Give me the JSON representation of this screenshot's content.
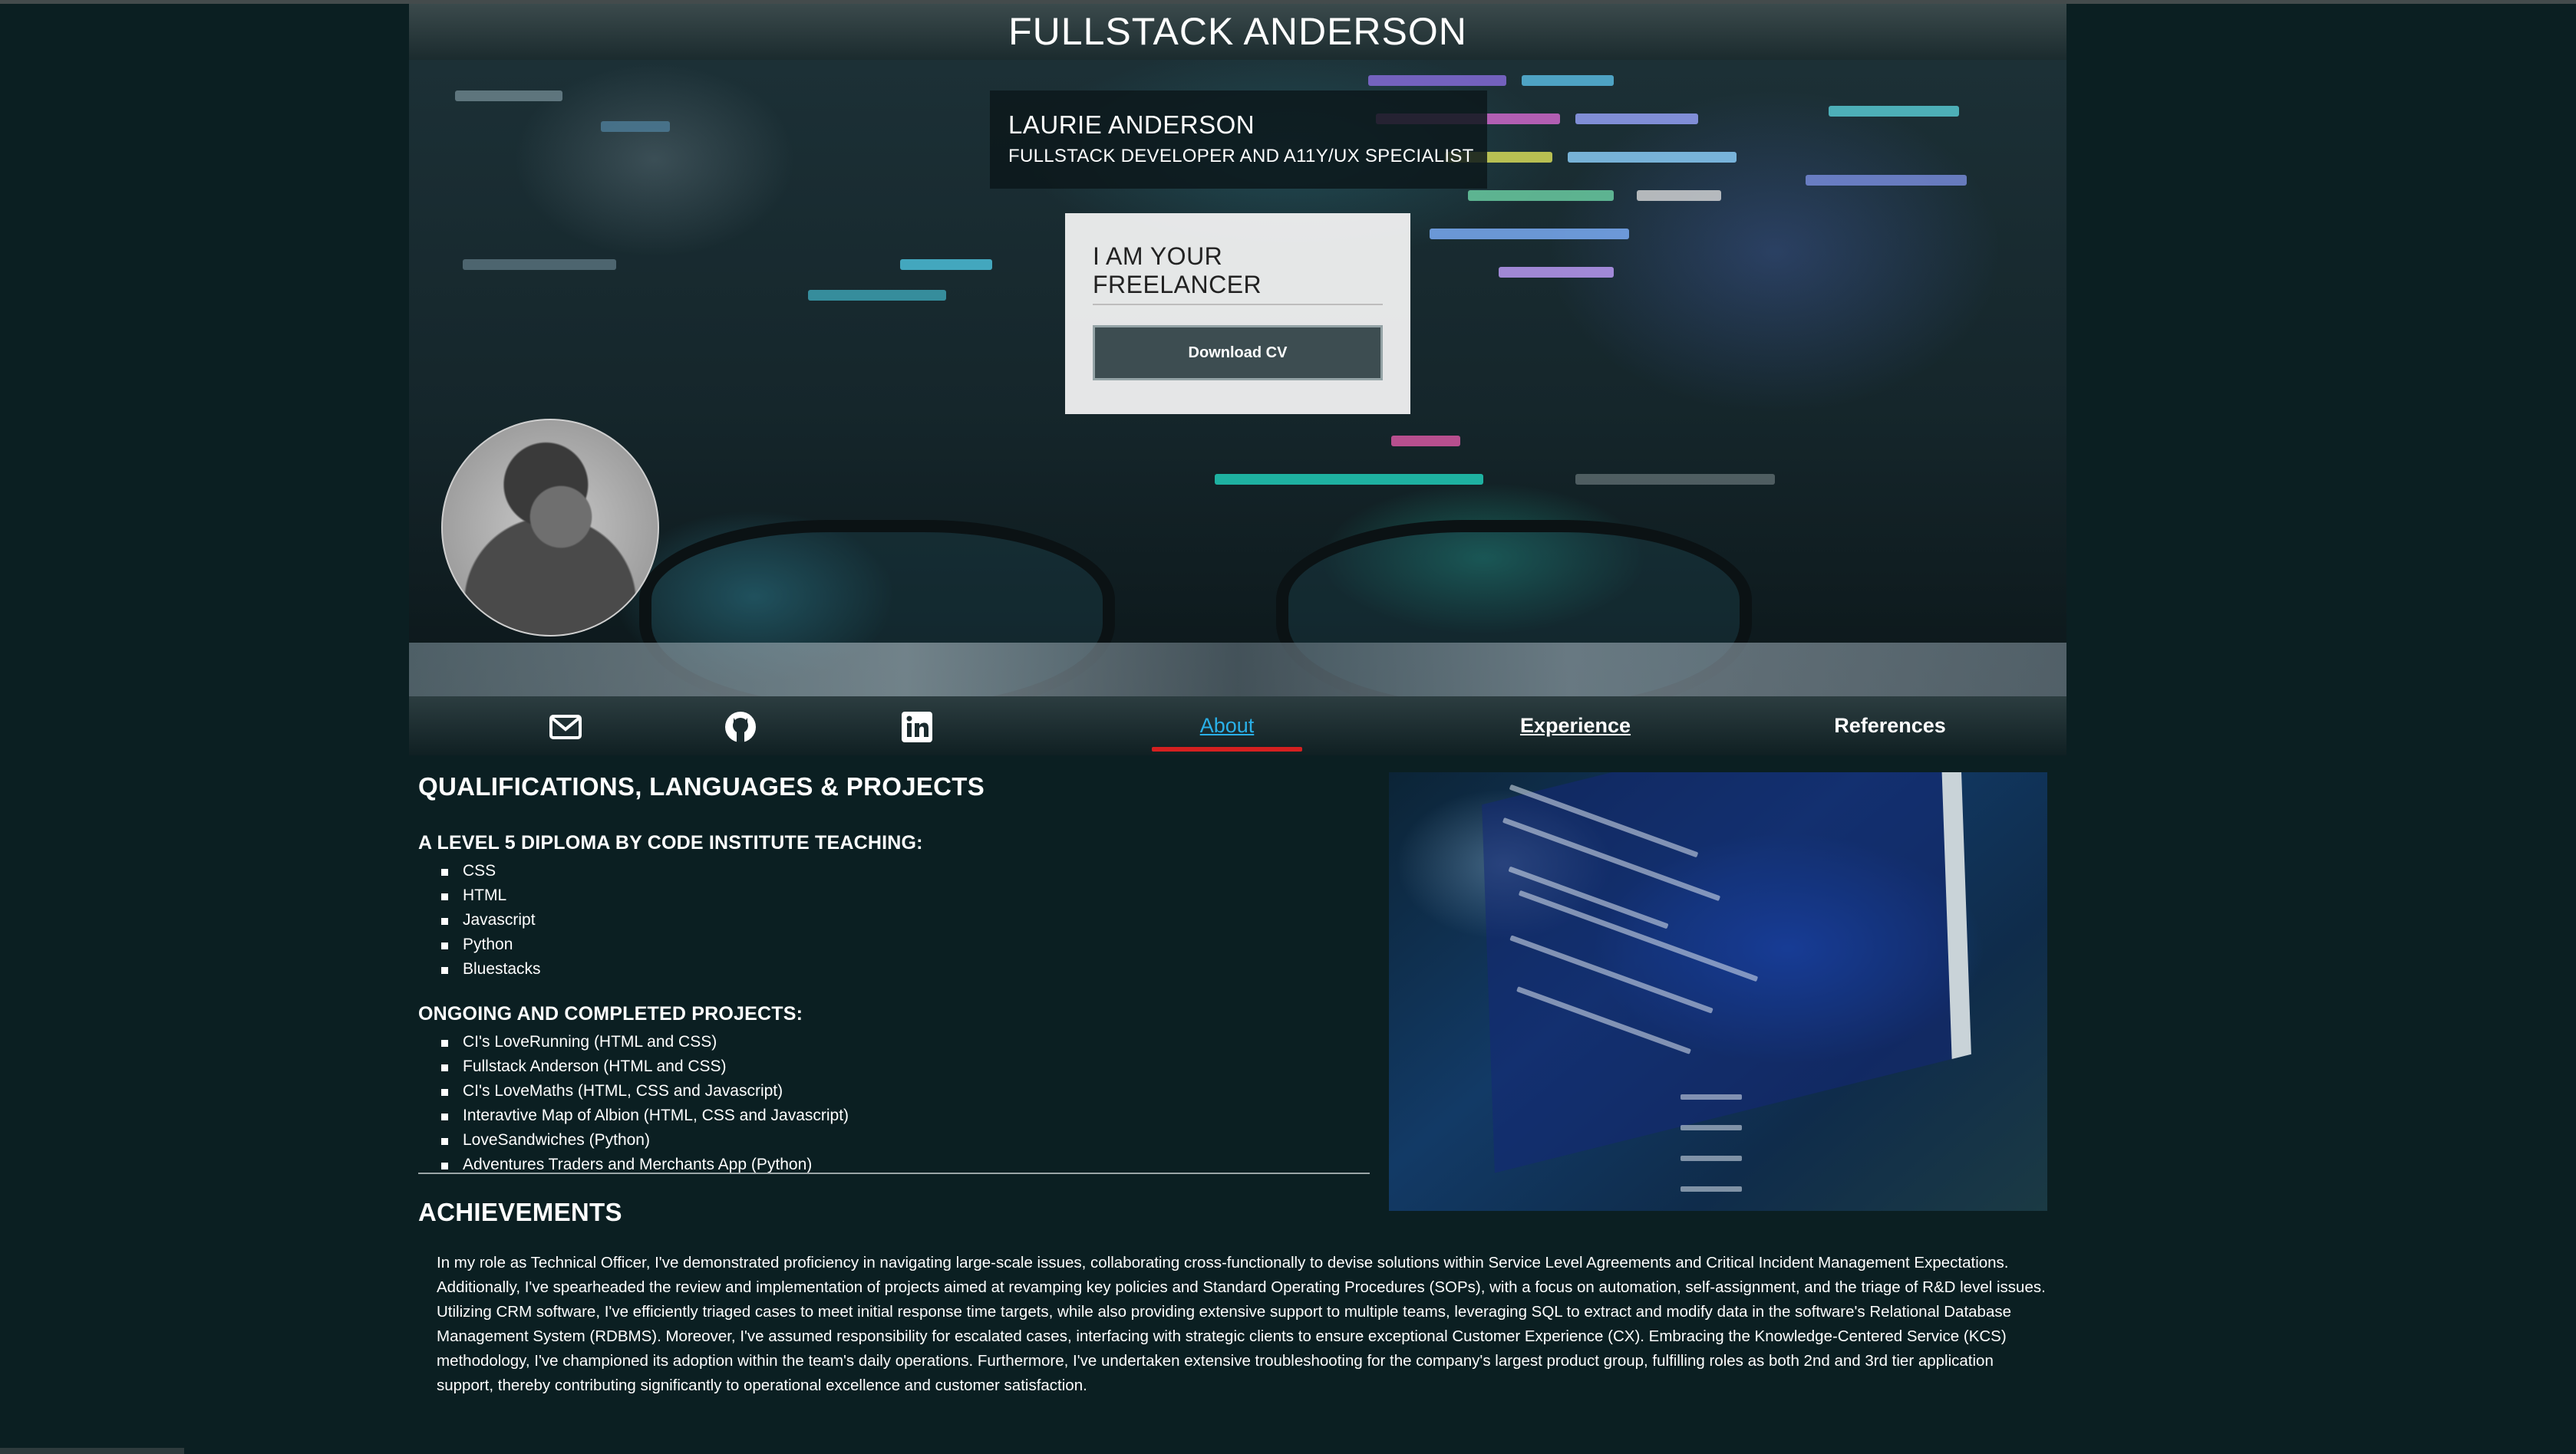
{
  "header": {
    "title": "FULLSTACK ANDERSON"
  },
  "hero": {
    "name": "LAURIE ANDERSON",
    "role": "FULLSTACK DEVELOPER AND A11Y/UX SPECIALIST",
    "freelancer_heading": "I AM YOUR FREELANCER",
    "cv_button": "Download CV"
  },
  "nav": {
    "icons": [
      "envelope-icon",
      "github-icon",
      "linkedin-icon"
    ],
    "links": {
      "about": "About",
      "experience": "Experience",
      "references": "References"
    },
    "active": "About",
    "active_color": "#2ab0e8",
    "active_underline_color": "#d42020"
  },
  "about": {
    "title": "QUALIFICATIONS, LANGUAGES & PROJECTS",
    "diploma_heading": "A LEVEL 5 DIPLOMA BY CODE INSTITUTE TEACHING:",
    "skills": [
      "CSS",
      "HTML",
      "Javascript",
      "Python",
      "Bluestacks"
    ],
    "projects_heading": "ONGOING AND COMPLETED PROJECTS:",
    "projects": [
      "CI's LoveRunning (HTML and CSS)",
      "Fullstack Anderson (HTML and CSS)",
      "CI's LoveMaths (HTML, CSS and Javascript)",
      "Interavtive Map of Albion (HTML, CSS and Javascript)",
      "LoveSandwiches (Python)",
      "Adventures Traders and Merchants App (Python)"
    ]
  },
  "achievements": {
    "title": "ACHIEVEMENTS",
    "text": "In my role as Technical Officer, I've demonstrated proficiency in navigating large-scale issues, collaborating cross-functionally to devise solutions within Service Level Agreements and Critical Incident Management Expectations. Additionally, I've spearheaded the review and implementation of projects aimed at revamping key policies and Standard Operating Procedures (SOPs), with a focus on automation, self-assignment, and the triage of R&D level issues. Utilizing CRM software, I've efficiently triaged cases to meet initial response time targets, while also providing extensive support to multiple teams, leveraging SQL to extract and modify data in the software's Relational Database Management System (RDBMS). Moreover, I've assumed responsibility for escalated cases, interfacing with strategic clients to ensure exceptional Customer Experience (CX). Embracing the Knowledge-Centered Service (KCS) methodology, I've championed its adoption within the team's daily operations. Furthermore, I've undertaken extensive troubleshooting for the company's largest product group, fulfilling roles as both 2nd and 3rd tier application support, thereby contributing significantly to operational excellence and customer satisfaction."
  }
}
